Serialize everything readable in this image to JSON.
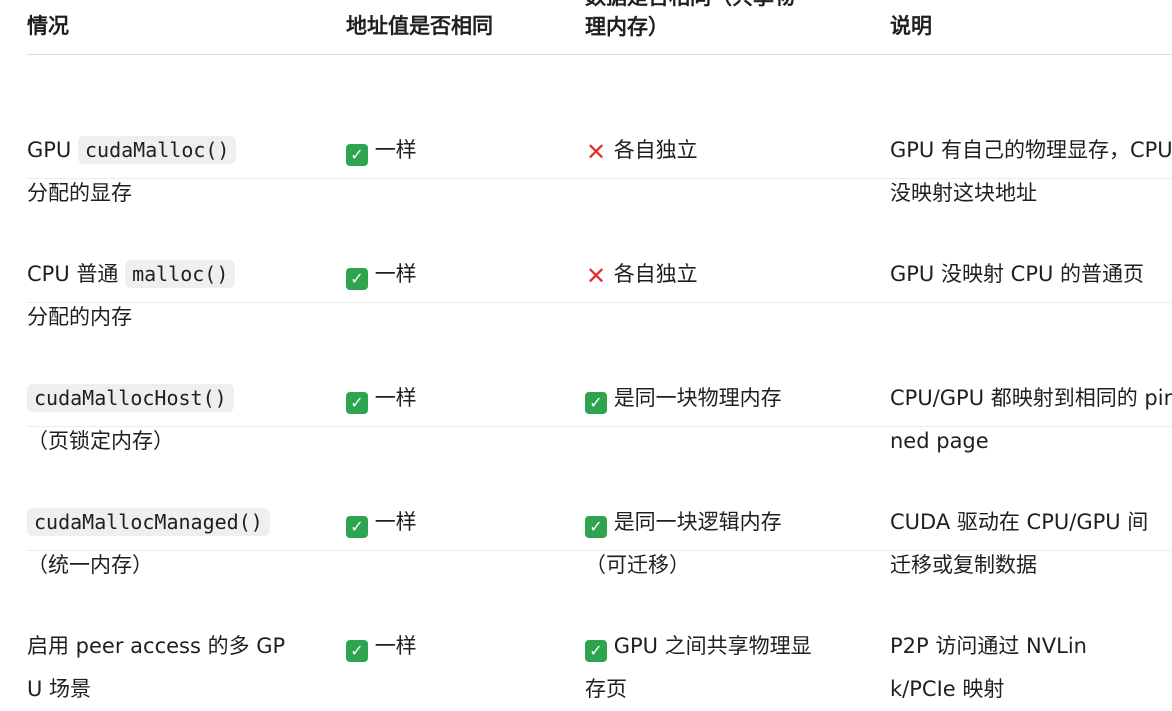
{
  "colors": {
    "check_bg": "#2ea44f",
    "cross": "#e03131",
    "code_bg": "#efefef",
    "divider": "#ececec"
  },
  "header": {
    "col1": "情况",
    "col2": "地址值是否相同",
    "col3_line1": "数据是否相同（共享物",
    "col3_line2": "理内存）",
    "col4": "说明"
  },
  "rows": [
    {
      "case_prefix": "GPU ",
      "case_code": "cudaMalloc()",
      "case_suffix": "分配的显存",
      "addr_mark": "check-icon",
      "addr_text": "一样",
      "data_mark": "cross-icon",
      "data_text": "各自独立",
      "note": "GPU 有自己的物理显存，CPU 没映射这块地址"
    },
    {
      "case_prefix": "CPU 普通 ",
      "case_code": "malloc()",
      "case_suffix": "分配的内存",
      "addr_mark": "check-icon",
      "addr_text": "一样",
      "data_mark": "cross-icon",
      "data_text": "各自独立",
      "note": "GPU 没映射 CPU 的普通页"
    },
    {
      "case_prefix": "",
      "case_code": "cudaMallocHost()",
      "case_suffix": "（页锁定内存）",
      "addr_mark": "check-icon",
      "addr_text": "一样",
      "data_mark": "check-icon",
      "data_text": "是同一块物理内存",
      "note": "CPU/GPU 都映射到相同的 pinned page"
    },
    {
      "case_prefix": "",
      "case_code": "cudaMallocManaged()",
      "case_suffix": "（统一内存）",
      "addr_mark": "check-icon",
      "addr_text": "一样",
      "data_mark": "check-icon",
      "data_text": "是同一块逻辑内存（可迁移）",
      "note": "CUDA 驱动在 CPU/GPU 间迁移或复制数据"
    },
    {
      "case_prefix": "启用 peer access 的多 GPU 场景",
      "case_code": "",
      "case_suffix": "",
      "addr_mark": "check-icon",
      "addr_text": "一样",
      "data_mark": "check-icon",
      "data_text": "GPU 之间共享物理显存页",
      "note": "P2P 访问通过 NVLink/PCIe 映射"
    }
  ]
}
